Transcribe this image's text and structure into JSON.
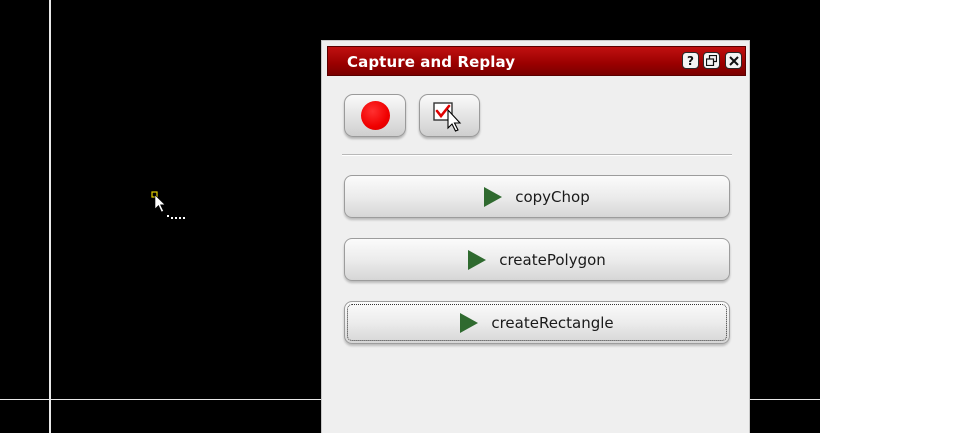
{
  "dialog": {
    "title": "Capture and Replay",
    "titlebar_buttons": {
      "help": "?",
      "restore": "restore-icon",
      "close": "close-icon"
    },
    "toolbar": {
      "record_icon": "record-icon",
      "check_icon": "checkbox-cursor-icon"
    },
    "macros": [
      {
        "label": "copyChop",
        "icon": "play-icon"
      },
      {
        "label": "createPolygon",
        "icon": "play-icon"
      },
      {
        "label": "createRectangle",
        "icon": "play-icon"
      }
    ]
  },
  "colors": {
    "canvas": "#000000",
    "title_bar": "#9a0000",
    "record": "#f00000",
    "play": "#2f6a2f"
  }
}
